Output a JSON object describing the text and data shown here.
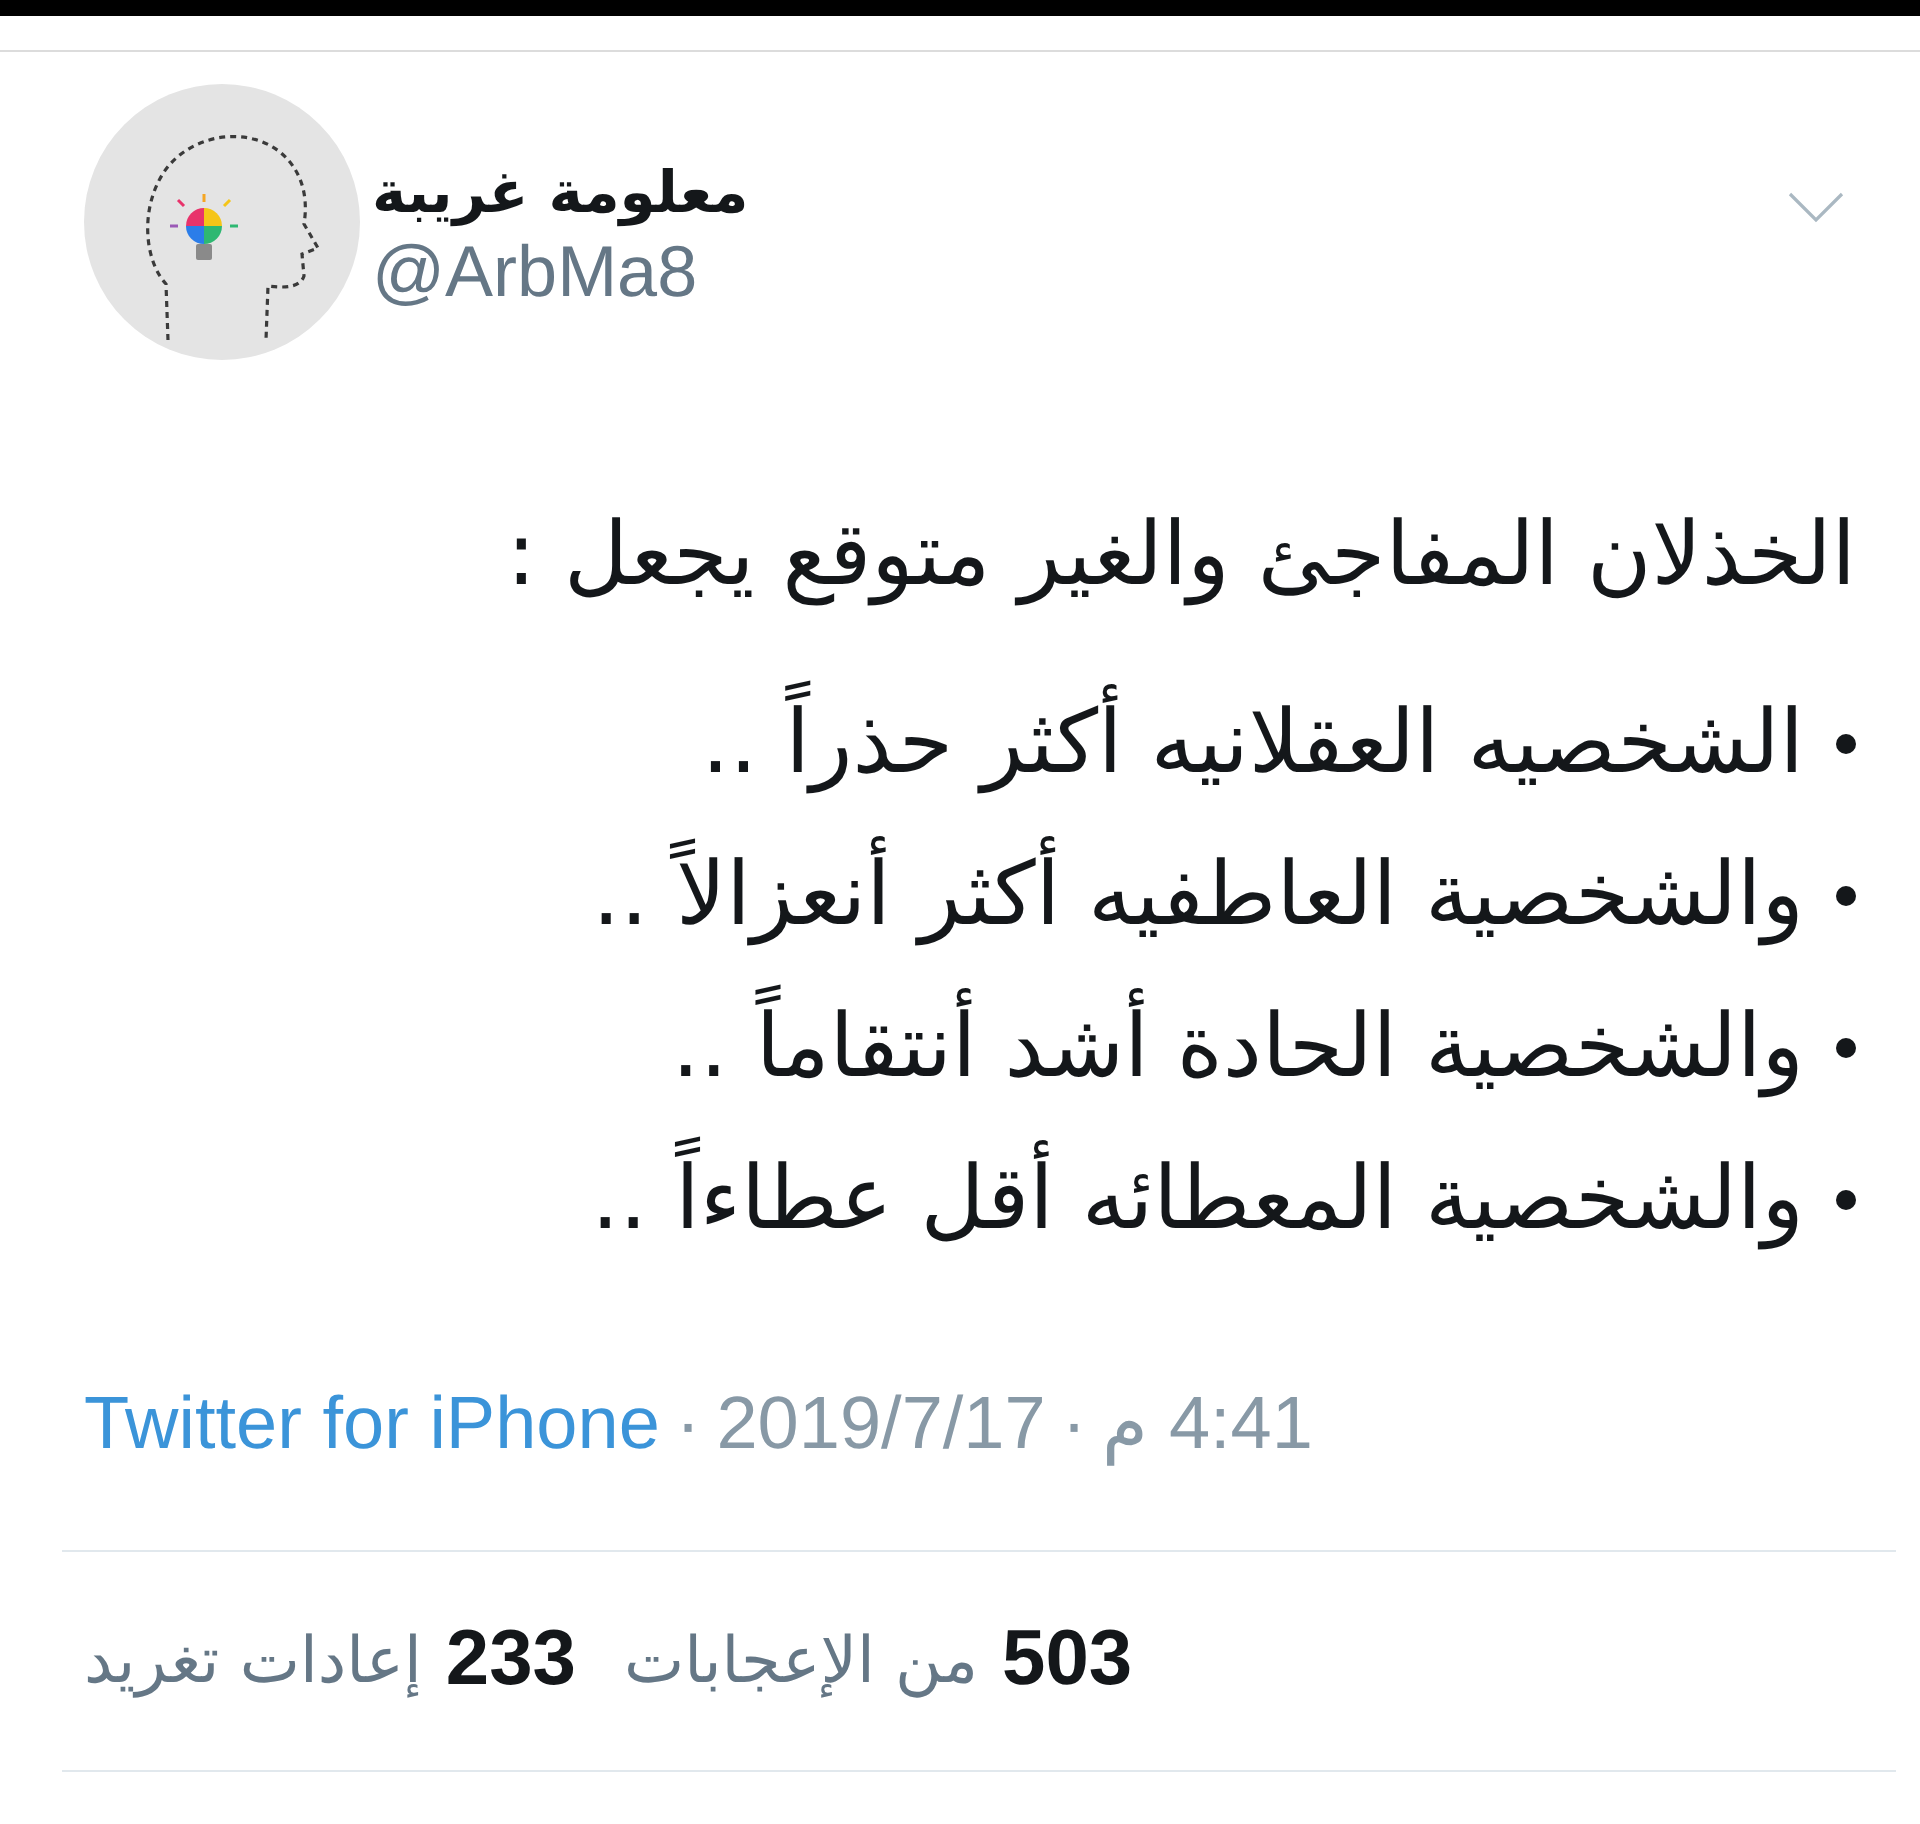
{
  "header": {
    "display_name": "معلومة غريبة",
    "handle": "@ArbMa8"
  },
  "tweet": {
    "heading": "الخذلان المفاجئ والغير متوقع يجعل :",
    "bullets": [
      "الشخصيه العقلانيه أكثر حذراً ..",
      "والشخصية العاطفيه أكثر أنعزالاً ..",
      "والشخصية الحادة أشد أنتقاماً ..",
      "والشخصية المعطائه أقل عطاءاً .."
    ]
  },
  "meta": [
    {
      "kind": "time",
      "text": "4:41 م"
    },
    {
      "kind": "separator",
      "text": "·"
    },
    {
      "kind": "date",
      "text": "2019/7/17"
    },
    {
      "kind": "separator",
      "text": "·"
    },
    {
      "kind": "source",
      "text": "Twitter for iPhone"
    }
  ],
  "stats": [
    {
      "count": "503",
      "label": "من الإعجابات"
    },
    {
      "count": "233",
      "label": "إعادات تغريد"
    }
  ]
}
